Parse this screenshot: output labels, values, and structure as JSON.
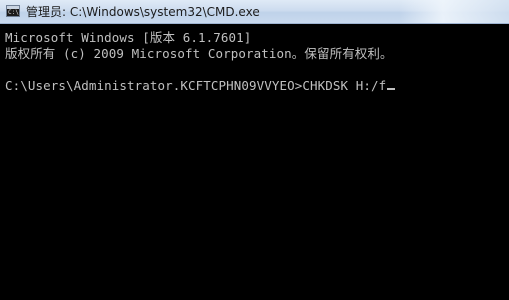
{
  "window": {
    "title": "管理员: C:\\Windows\\system32\\CMD.exe",
    "icon": "cmd-console-icon",
    "title_bar_color": "#cddcef"
  },
  "console": {
    "background": "#000000",
    "text_color": "#c0c0c0",
    "lines": [
      "Microsoft Windows [版本 6.1.7601]",
      "版权所有 (c) 2009 Microsoft Corporation。保留所有权利。",
      "",
      "C:\\Users\\Administrator.KCFTCPHN09VVYEO>CHKDSK H:/f"
    ],
    "cursor": "_"
  }
}
